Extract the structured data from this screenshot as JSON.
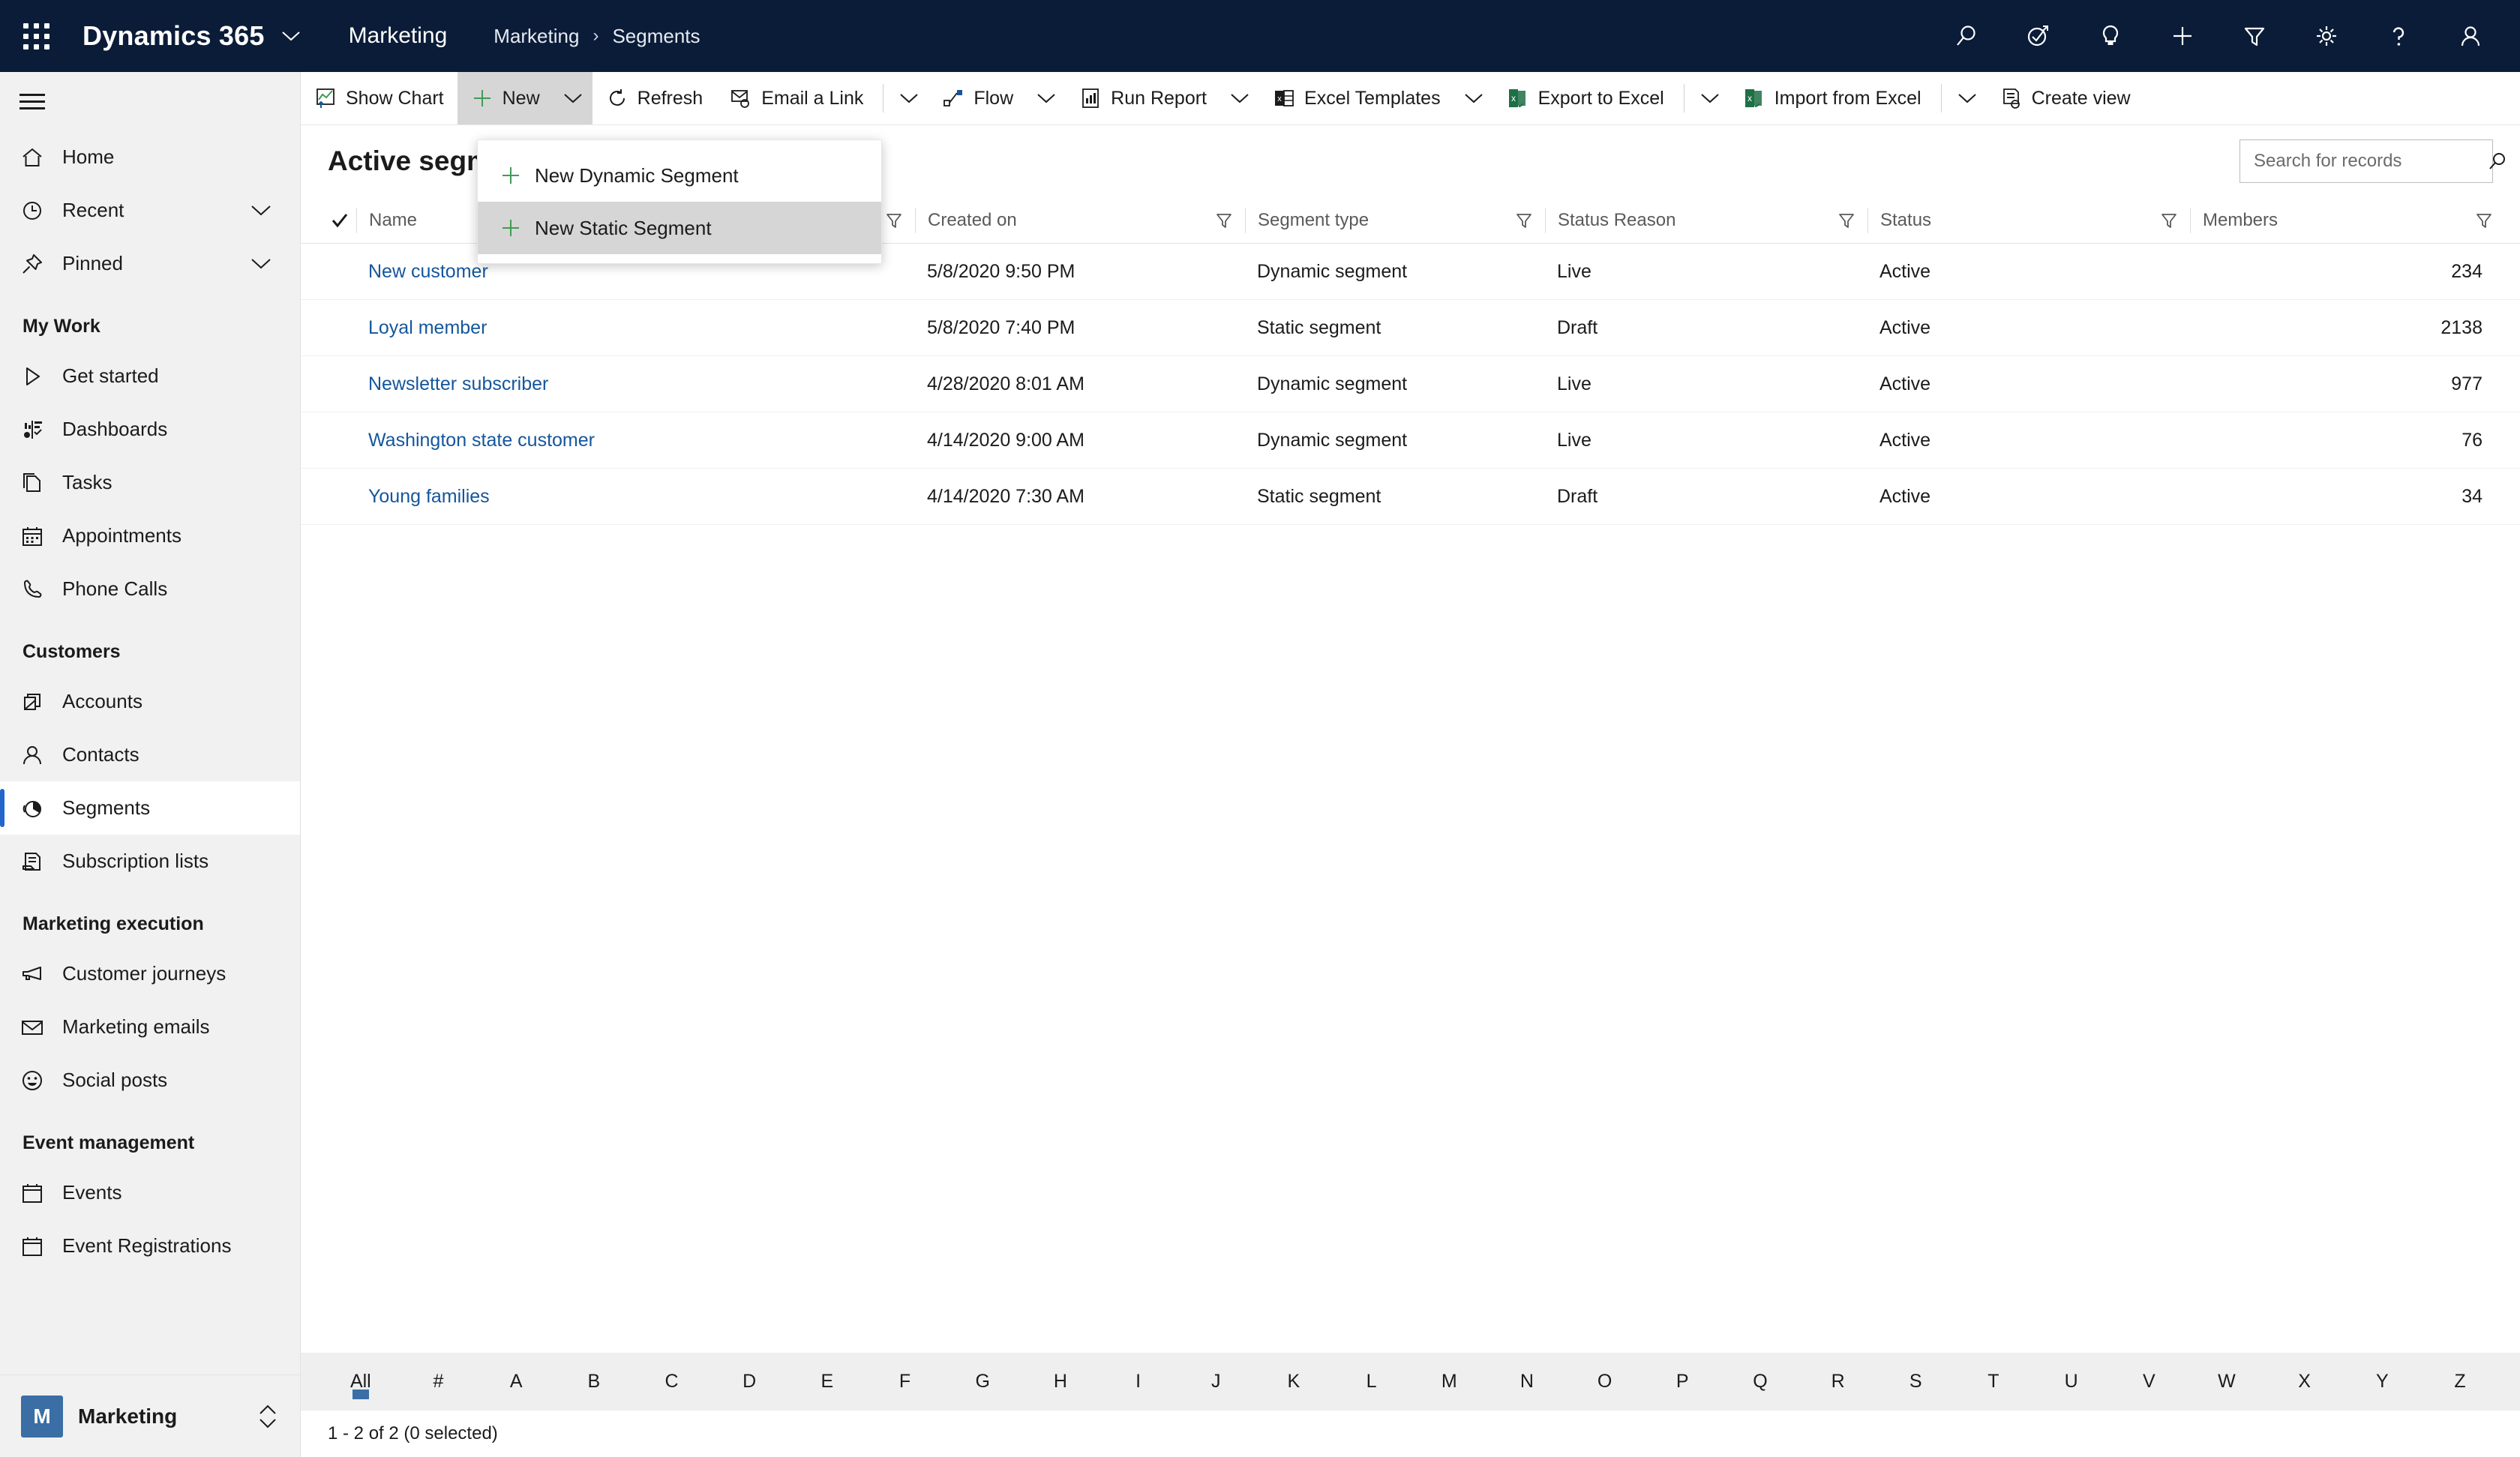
{
  "topnav": {
    "waffle_label": "app-launcher",
    "brand": "Dynamics 365",
    "app_name": "Marketing",
    "breadcrumb": [
      "Marketing",
      "Segments"
    ],
    "breadcrumb_separator": "›",
    "icons": [
      {
        "name": "search-icon",
        "label": "Search"
      },
      {
        "name": "diagnostics-icon",
        "label": "Diagnostics"
      },
      {
        "name": "lightbulb-icon",
        "label": "Insights"
      },
      {
        "name": "plus-icon",
        "label": "Quick create"
      },
      {
        "name": "filter-icon",
        "label": "Filter"
      },
      {
        "name": "gear-icon",
        "label": "Settings"
      },
      {
        "name": "help-icon",
        "label": "Help"
      },
      {
        "name": "account-icon",
        "label": "Account manager"
      }
    ]
  },
  "sidebar": {
    "hamburger_label": "Expand / collapse site map",
    "top_items": [
      {
        "label": "Home",
        "icon": "home-icon",
        "chevron": false
      },
      {
        "label": "Recent",
        "icon": "clock-icon",
        "chevron": true
      },
      {
        "label": "Pinned",
        "icon": "pin-icon",
        "chevron": true
      }
    ],
    "groups": [
      {
        "title": "My Work",
        "items": [
          {
            "label": "Get started",
            "icon": "play-icon"
          },
          {
            "label": "Dashboards",
            "icon": "dashboard-icon"
          },
          {
            "label": "Tasks",
            "icon": "tasks-icon"
          },
          {
            "label": "Appointments",
            "icon": "calendar-icon"
          },
          {
            "label": "Phone Calls",
            "icon": "phone-icon"
          }
        ]
      },
      {
        "title": "Customers",
        "items": [
          {
            "label": "Accounts",
            "icon": "accounts-icon"
          },
          {
            "label": "Contacts",
            "icon": "contact-icon"
          },
          {
            "label": "Segments",
            "icon": "segments-icon",
            "selected": true
          },
          {
            "label": "Subscription lists",
            "icon": "subscription-icon"
          }
        ]
      },
      {
        "title": "Marketing execution",
        "items": [
          {
            "label": "Customer journeys",
            "icon": "megaphone-icon"
          },
          {
            "label": "Marketing emails",
            "icon": "envelope-icon"
          },
          {
            "label": "Social posts",
            "icon": "smiley-icon"
          }
        ]
      },
      {
        "title": "Event management",
        "items": [
          {
            "label": "Events",
            "icon": "calendar-icon"
          },
          {
            "label": "Event Registrations",
            "icon": "calendar-icon"
          }
        ]
      }
    ],
    "area_switcher": {
      "badge": "M",
      "label": "Marketing",
      "icon": "updown-chevron-icon"
    }
  },
  "commandbar": {
    "items": [
      {
        "label": "Show Chart",
        "icon": "chart-icon",
        "chevron": false,
        "active": false
      },
      {
        "label": "New",
        "icon": "plus-green-icon",
        "chevron": true,
        "active": true
      },
      {
        "label": "Refresh",
        "icon": "refresh-icon",
        "chevron": false,
        "active": false
      },
      {
        "label": "Email a Link",
        "icon": "email-link-icon",
        "chevron": true,
        "separator": true,
        "active": false
      },
      {
        "label": "Flow",
        "icon": "flow-icon",
        "chevron": true,
        "active": false
      },
      {
        "label": "Run Report",
        "icon": "report-icon",
        "chevron": true,
        "active": false
      },
      {
        "label": "Excel Templates",
        "icon": "excel-template-icon",
        "chevron": true,
        "active": false
      },
      {
        "label": "Export to Excel",
        "icon": "excel-icon",
        "chevron": true,
        "separator": true,
        "active": false
      },
      {
        "label": "Import from Excel",
        "icon": "excel-icon",
        "chevron": true,
        "separator": true,
        "active": false
      },
      {
        "label": "Create view",
        "icon": "create-view-icon",
        "chevron": false,
        "active": false
      }
    ]
  },
  "new_menu": {
    "items": [
      {
        "label": "New Dynamic Segment",
        "icon": "plus-green-icon",
        "hovered": false
      },
      {
        "label": "New Static Segment",
        "icon": "plus-green-icon",
        "hovered": true
      }
    ]
  },
  "view": {
    "title": "Active segments",
    "search_placeholder": "Search for records",
    "search_value": ""
  },
  "grid": {
    "columns": [
      {
        "label": "Name",
        "sorted": true,
        "sort_dir": "↑",
        "filter": true
      },
      {
        "label": "Created on",
        "sorted": false,
        "filter": true
      },
      {
        "label": "Segment type",
        "sorted": false,
        "filter": true
      },
      {
        "label": "Status Reason",
        "sorted": false,
        "filter": true
      },
      {
        "label": "Status",
        "sorted": false,
        "filter": true
      },
      {
        "label": "Members",
        "sorted": false,
        "filter": true
      }
    ],
    "rows": [
      {
        "name": "New customer",
        "created_on": "5/8/2020 9:50 PM",
        "segment_type": "Dynamic segment",
        "status_reason": "Live",
        "status": "Active",
        "members": "234"
      },
      {
        "name": "Loyal member",
        "created_on": "5/8/2020 7:40 PM",
        "segment_type": "Static segment",
        "status_reason": "Draft",
        "status": "Active",
        "members": "2138"
      },
      {
        "name": "Newsletter subscriber",
        "created_on": "4/28/2020 8:01 AM",
        "segment_type": "Dynamic segment",
        "status_reason": "Live",
        "status": "Active",
        "members": "977"
      },
      {
        "name": "Washington state customer",
        "created_on": "4/14/2020 9:00 AM",
        "segment_type": "Dynamic segment",
        "status_reason": "Live",
        "status": "Active",
        "members": "76"
      },
      {
        "name": "Young families",
        "created_on": "4/14/2020 7:30 AM",
        "segment_type": "Static segment",
        "status_reason": "Draft",
        "status": "Active",
        "members": "34"
      }
    ]
  },
  "alphabar": {
    "letters": [
      "All",
      "#",
      "A",
      "B",
      "C",
      "D",
      "E",
      "F",
      "G",
      "H",
      "I",
      "J",
      "K",
      "L",
      "M",
      "N",
      "O",
      "P",
      "Q",
      "R",
      "S",
      "T",
      "U",
      "V",
      "W",
      "X",
      "Y",
      "Z"
    ],
    "selected": "All"
  },
  "statusbar": {
    "text": "1 - 2 of 2 (0 selected)"
  },
  "colors": {
    "nav_background": "#0b1c38",
    "link": "#14569c",
    "accent": "#3a6ea5",
    "selection_bar": "#2266cc",
    "excel_green": "#1d7044",
    "plus_green": "#3f9c52",
    "sidebar_background": "#f1f1f1"
  }
}
